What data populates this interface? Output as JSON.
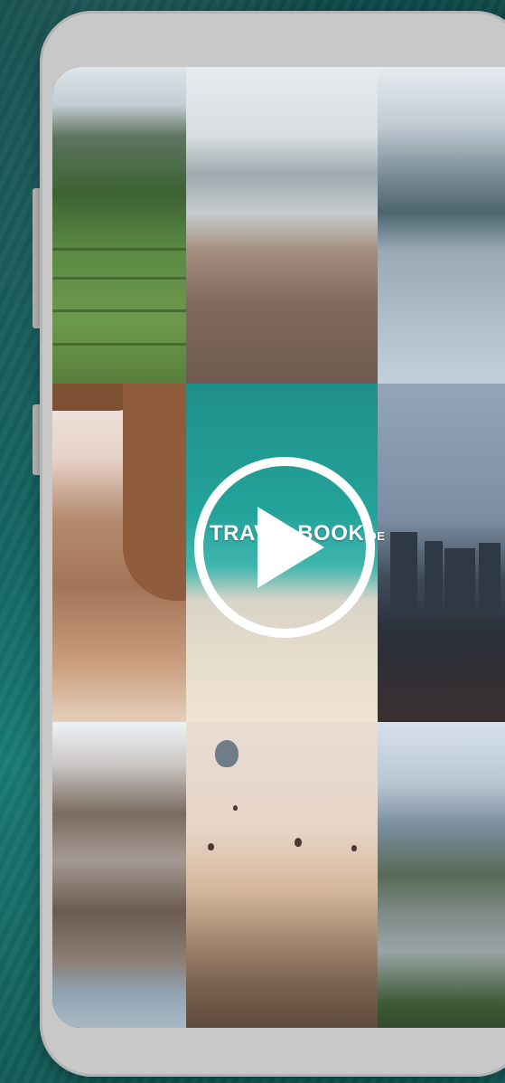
{
  "video": {
    "watermark": "TRAVELBOOK",
    "watermark_suffix": ".DE",
    "play_icon": "play-icon"
  },
  "colors": {
    "background": "#12605e",
    "phone_frame": "#c8c8c8",
    "play_overlay": "#ffffff"
  },
  "tiles": [
    {
      "icon": "rice-terrace-photo"
    },
    {
      "icon": "desert-valley-photo"
    },
    {
      "icon": "mountain-lake-photo"
    },
    {
      "icon": "petra-treasury-photo"
    },
    {
      "icon": "aerial-beach-photo"
    },
    {
      "icon": "city-skyline-dusk-photo"
    },
    {
      "icon": "glacier-mountain-photo"
    },
    {
      "icon": "hot-air-balloons-photo"
    },
    {
      "icon": "mountain-panorama-photo"
    }
  ]
}
